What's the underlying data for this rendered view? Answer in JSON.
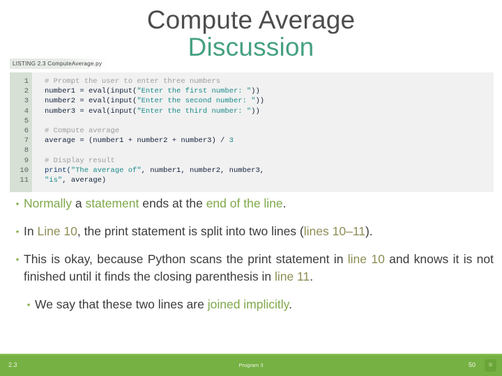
{
  "slide": {
    "title_line1": "Compute Average",
    "title_line2": "Discussion"
  },
  "listing": {
    "caption": "LISTING 2.3 ComputeAverage.py",
    "line_numbers": [
      "1",
      "2",
      "3",
      "4",
      "5",
      "6",
      "7",
      "8",
      "9",
      "10",
      "11"
    ],
    "code_lines": [
      "# Prompt the user to enter three numbers",
      "number1 = eval(input(\"Enter the first number: \"))",
      "number2 = eval(input(\"Enter the second number: \"))",
      "number3 = eval(input(\"Enter the third number: \"))",
      "",
      "# Compute average",
      "average = (number1 + number2 + number3) / 3",
      "",
      "# Display result",
      "print(\"The average of\", number1, number2, number3,",
      "\"is\", average)"
    ],
    "code_tokens": {
      "l1_comment": "# Prompt the user to enter three numbers",
      "l2_a": "number1 = eval(input(",
      "l2_s": "\"Enter the first number: \"",
      "l2_b": "))",
      "l3_a": "number2 = eval(input(",
      "l3_s": "\"Enter the second number: \"",
      "l3_b": "))",
      "l4_a": "number3 = eval(input(",
      "l4_s": "\"Enter the third number: \"",
      "l4_b": "))",
      "l6_comment": "# Compute average",
      "l7_a": "average = (number1 + number2 + number3) / ",
      "l7_n": "3",
      "l9_comment": "# Display result",
      "l10_kw": "print(",
      "l10_s": "\"The average of\"",
      "l10_b": ", number1, number2, number3,",
      "l11_s": "\"is\"",
      "l11_b": ", average)"
    }
  },
  "bullets": [
    {
      "marker": "•",
      "parts": [
        {
          "text": "Normally",
          "style": "bright"
        },
        {
          "text": " a ",
          "style": "plain"
        },
        {
          "text": "statement",
          "style": "bright"
        },
        {
          "text": " ends at the ",
          "style": "plain"
        },
        {
          "text": "end of the line",
          "style": "bright"
        },
        {
          "text": ".",
          "style": "plain"
        }
      ]
    },
    {
      "marker": "•",
      "parts": [
        {
          "text": "In ",
          "style": "plain"
        },
        {
          "text": "Line 10",
          "style": "olive"
        },
        {
          "text": ", the print statement is split into two lines (",
          "style": "plain"
        },
        {
          "text": "lines 10–11",
          "style": "olive"
        },
        {
          "text": ").",
          "style": "plain"
        }
      ]
    },
    {
      "marker": "•",
      "parts": [
        {
          "text": "This is okay, because Python scans the print statement in ",
          "style": "plain"
        },
        {
          "text": "line 10",
          "style": "olive"
        },
        {
          "text": " and knows it is not finished until it finds the closing parenthesis in ",
          "style": "plain"
        },
        {
          "text": "line 11",
          "style": "olive"
        },
        {
          "text": ".",
          "style": "plain"
        }
      ]
    },
    {
      "marker": "•",
      "parts": [
        {
          "text": "We say that these two lines are ",
          "style": "plain"
        },
        {
          "text": "joined implicitly",
          "style": "bright"
        },
        {
          "text": ".",
          "style": "plain"
        }
      ]
    }
  ],
  "footer": {
    "left": "2.3",
    "center": "Program 3",
    "right": "50",
    "icon": "menu-icon",
    "icon_glyph": "≡"
  },
  "colors": {
    "title_dark": "#4d4d4d",
    "title_accent": "#46a180",
    "bullet_marker": "#8aae4a",
    "highlight_bright_green": "#7fa84a",
    "highlight_olive": "#8e8d56",
    "footer_green": "#76b143",
    "gutter_green": "#d6e0d5",
    "code_bg": "#f1f1f1",
    "code_string": "#1b8a8a",
    "code_comment": "#9d9d9d"
  }
}
